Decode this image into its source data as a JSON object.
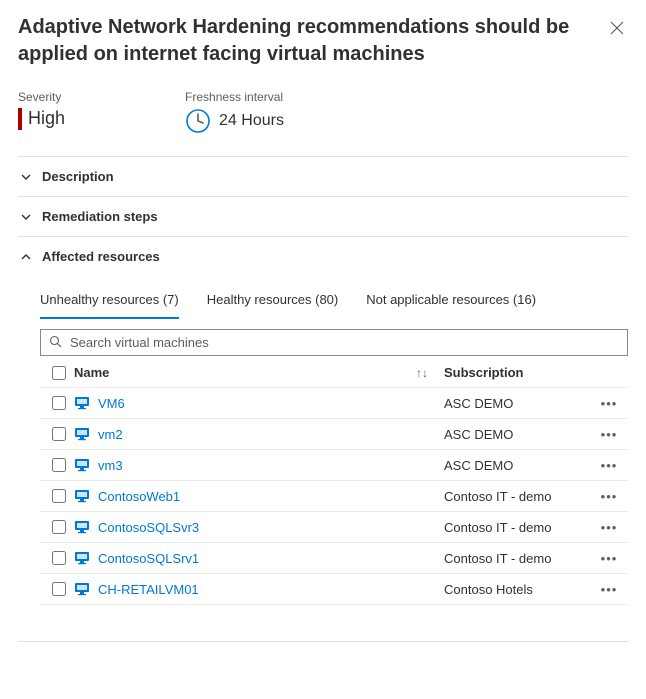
{
  "title": "Adaptive Network Hardening recommendations should be applied on internet facing virtual machines",
  "severity": {
    "label": "Severity",
    "value": "High"
  },
  "freshness": {
    "label": "Freshness interval",
    "value": "24 Hours"
  },
  "sections": {
    "description": "Description",
    "remediation": "Remediation steps",
    "affected": "Affected resources"
  },
  "tabs": {
    "unhealthy": "Unhealthy resources (7)",
    "healthy": "Healthy resources (80)",
    "na": "Not applicable resources (16)"
  },
  "search": {
    "placeholder": "Search virtual machines"
  },
  "columns": {
    "name": "Name",
    "subscription": "Subscription"
  },
  "rows": [
    {
      "name": "VM6",
      "subscription": "ASC DEMO"
    },
    {
      "name": "vm2",
      "subscription": "ASC DEMO"
    },
    {
      "name": "vm3",
      "subscription": "ASC DEMO"
    },
    {
      "name": "ContosoWeb1",
      "subscription": "Contoso IT - demo"
    },
    {
      "name": "ContosoSQLSvr3",
      "subscription": "Contoso IT - demo"
    },
    {
      "name": "ContosoSQLSrv1",
      "subscription": "Contoso IT - demo"
    },
    {
      "name": "CH-RETAILVM01",
      "subscription": "Contoso Hotels"
    }
  ]
}
